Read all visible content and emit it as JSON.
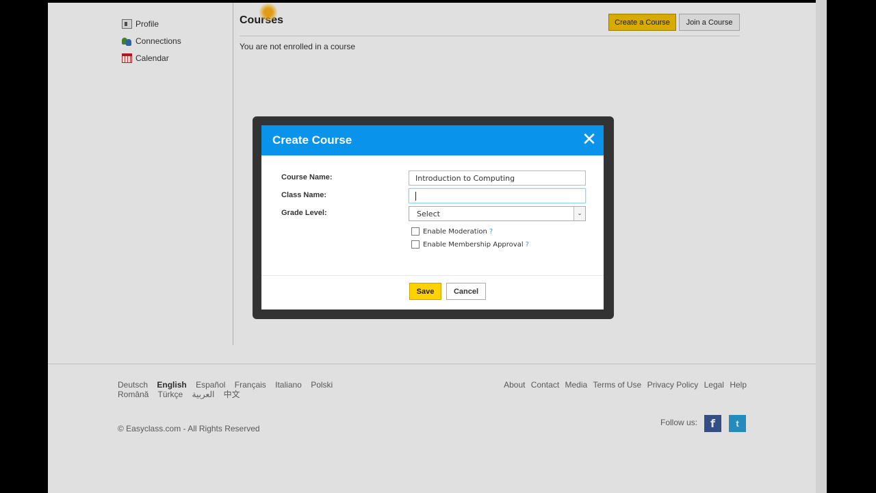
{
  "sidebar": {
    "items": [
      {
        "label": "Profile",
        "icon": "profile-icon"
      },
      {
        "label": "Connections",
        "icon": "connections-icon"
      },
      {
        "label": "Calendar",
        "icon": "calendar-icon"
      }
    ]
  },
  "main": {
    "title": "Courses",
    "empty_message": "You are not enrolled in a course",
    "create_button": "Create a Course",
    "join_button": "Join a Course"
  },
  "modal": {
    "title": "Create Course",
    "close_glyph": "✕",
    "fields": {
      "course_name_label": "Course Name:",
      "course_name_value": "Introduction to Computing",
      "class_name_label": "Class Name:",
      "class_name_value": "",
      "grade_level_label": "Grade Level:",
      "grade_level_value": "Select"
    },
    "checkboxes": {
      "moderation": "Enable Moderation",
      "membership": "Enable Membership Approval",
      "help_glyph": "?"
    },
    "save_button": "Save",
    "cancel_button": "Cancel"
  },
  "footer": {
    "languages_row1": [
      "Deutsch",
      "English",
      "Español",
      "Français",
      "Italiano",
      "Polski"
    ],
    "languages_row2": [
      "Română",
      "Türkçe",
      "العربية",
      "中文"
    ],
    "active_language": "English",
    "links": [
      "About",
      "Contact",
      "Media",
      "Terms of Use",
      "Privacy Policy",
      "Legal",
      "Help"
    ],
    "copyright": "© Easyclass.com - All Rights Reserved",
    "follow_label": "Follow us:",
    "facebook_glyph": "f",
    "twitter_glyph": "t"
  },
  "colors": {
    "accent_blue": "#0a93ea",
    "button_yellow": "#f5c200"
  }
}
